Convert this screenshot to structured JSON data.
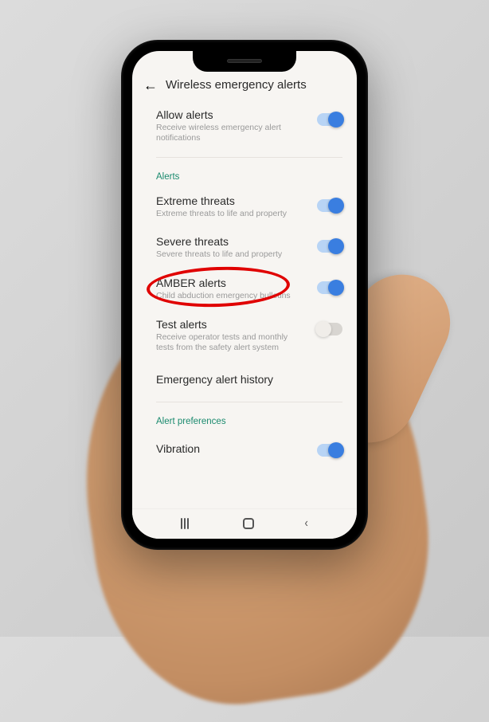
{
  "header": {
    "title": "Wireless emergency alerts"
  },
  "rows": {
    "allow": {
      "title": "Allow alerts",
      "desc": "Receive wireless emergency alert notifications",
      "on": true
    },
    "section_alerts": "Alerts",
    "extreme": {
      "title": "Extreme threats",
      "desc": "Extreme threats to life and property",
      "on": true
    },
    "severe": {
      "title": "Severe threats",
      "desc": "Severe threats to life and property",
      "on": true
    },
    "amber": {
      "title": "AMBER alerts",
      "desc": "Child abduction emergency bulletins",
      "on": true
    },
    "test": {
      "title": "Test alerts",
      "desc": "Receive operator tests and monthly tests from the safety alert system",
      "on": false
    },
    "history": {
      "title": "Emergency alert history"
    },
    "section_prefs": "Alert preferences",
    "vibration": {
      "title": "Vibration",
      "on": true
    }
  }
}
